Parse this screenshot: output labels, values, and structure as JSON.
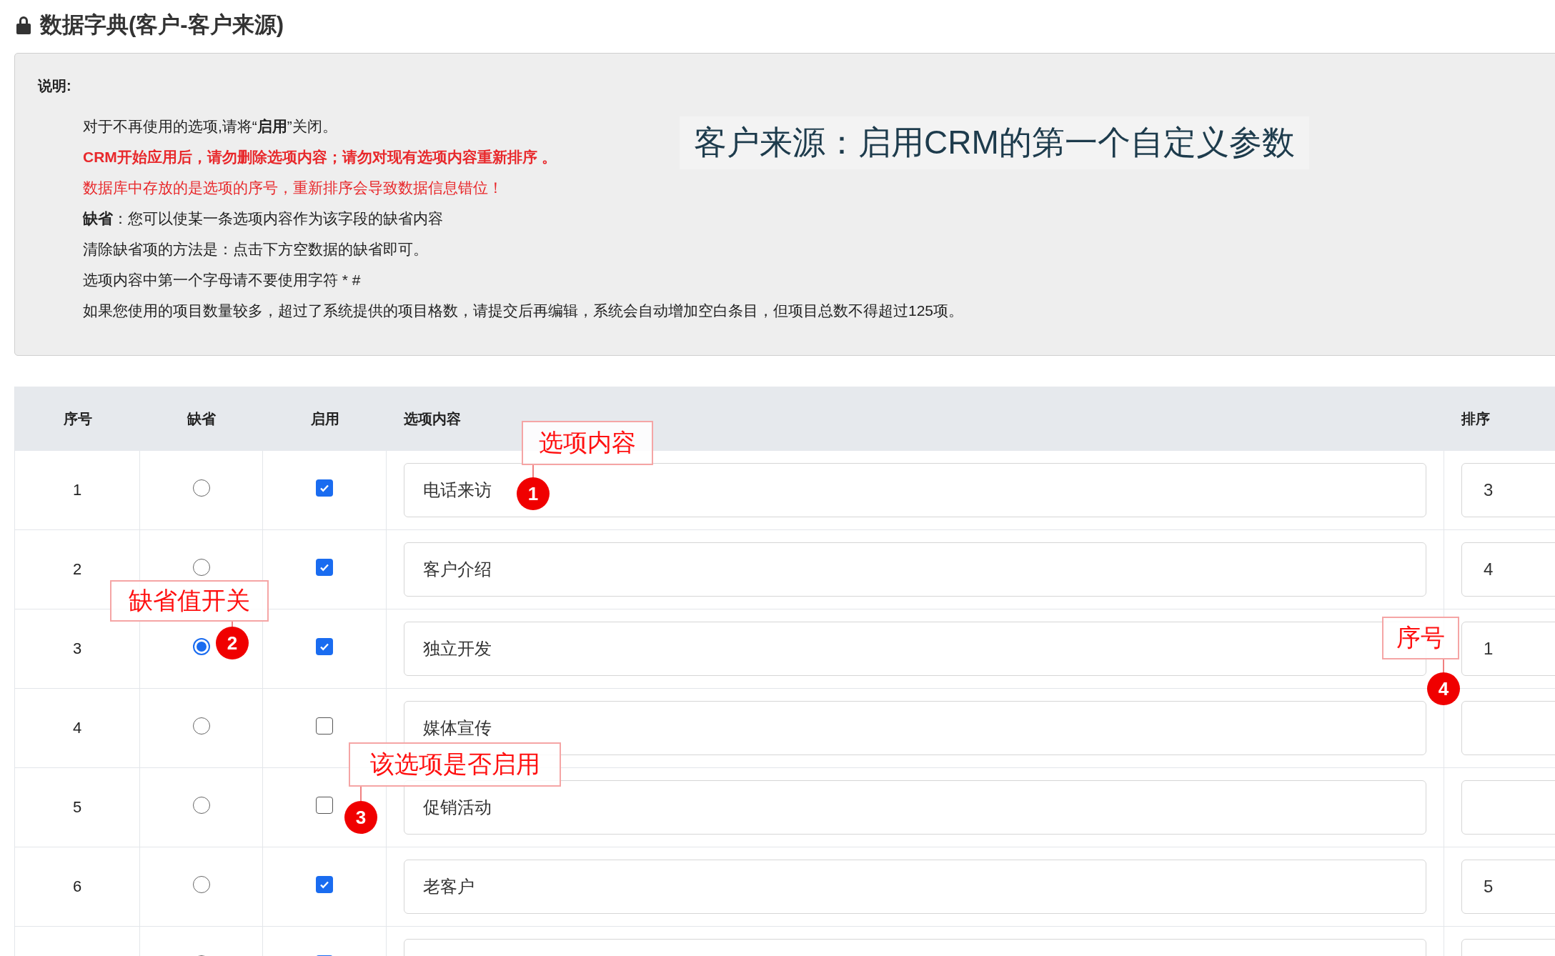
{
  "title": "数据字典(客户-客户来源)",
  "notes": {
    "heading": "说明:",
    "lines": [
      {
        "kind": "normal",
        "text": "对于不再使用的选项,请将“**启用**”关闭。"
      },
      {
        "kind": "warning_bold",
        "text": "CRM开始应用后，请勿删除选项内容；请勿对现有选项内容重新排序 。"
      },
      {
        "kind": "warning",
        "text": "数据库中存放的是选项的序号，重新排序会导致数据信息错位！"
      },
      {
        "kind": "normal",
        "text": "**缺省**：您可以使某一条选项内容作为该字段的缺省内容"
      },
      {
        "kind": "normal",
        "text": "清除缺省项的方法是：点击下方空数据的缺省即可。"
      },
      {
        "kind": "normal",
        "text": "选项内容中第一个字母请不要使用字符 * #"
      },
      {
        "kind": "normal",
        "text": "如果您使用的项目数量较多，超过了系统提供的项目格数，请提交后再编辑，系统会自动增加空白条目，但项目总数不得超过125项。"
      }
    ],
    "callout": "客户来源：启用CRM的第一个自定义参数"
  },
  "table": {
    "columns": [
      "序号",
      "缺省",
      "启用",
      "选项内容",
      "排序"
    ],
    "rows": [
      {
        "index": "1",
        "default": false,
        "enabled": true,
        "content": "电话来访",
        "order": "3"
      },
      {
        "index": "2",
        "default": false,
        "enabled": true,
        "content": "客户介绍",
        "order": "4"
      },
      {
        "index": "3",
        "default": true,
        "enabled": true,
        "content": "独立开发",
        "order": "1"
      },
      {
        "index": "4",
        "default": false,
        "enabled": false,
        "content": "媒体宣传"
      },
      {
        "index": "5",
        "default": false,
        "enabled": false,
        "content": "促销活动"
      },
      {
        "index": "6",
        "default": false,
        "enabled": true,
        "content": "老客户",
        "order": "5"
      },
      {
        "default": false,
        "enabled": true
      }
    ]
  },
  "annotations": [
    {
      "label": "选项内容",
      "number": "1"
    },
    {
      "label": "缺省值开关",
      "number": "2"
    },
    {
      "label": "该选项是否启用",
      "number": "3"
    },
    {
      "label": "序号",
      "number": "4"
    }
  ]
}
